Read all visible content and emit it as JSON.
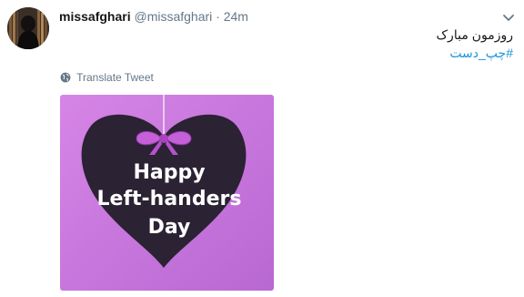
{
  "tweet": {
    "display_name": "missafghari",
    "handle": "@missafghari",
    "separator": "·",
    "time": "24m",
    "text_line1": "روزمون مبارک",
    "hashtag": "#چپ_دست",
    "translate_label": "Translate Tweet"
  },
  "media": {
    "image_text_line1": "Happy",
    "image_text_line2": "Left-handers",
    "image_text_line3": "Day"
  },
  "icons": {
    "avatar": "avatar",
    "globe": "globe-icon",
    "more": "chevron-down-icon"
  },
  "colors": {
    "link": "#1b95e0",
    "muted": "#657786",
    "image_background": "#d982ea",
    "heart": "#2b2233",
    "ribbon": "#c560d8"
  }
}
